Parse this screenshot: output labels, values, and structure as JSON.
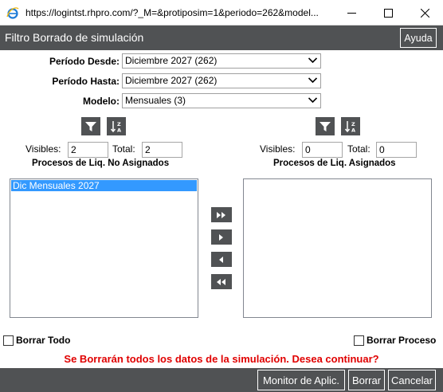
{
  "window": {
    "url": "https://logintst.rhpro.com/?_M=&protiposim=1&periodo=262&model...",
    "controls": [
      "minimize",
      "maximize",
      "close"
    ]
  },
  "header": {
    "title": "Filtro Borrado de simulación",
    "help_label": "Ayuda"
  },
  "form": {
    "periodo_desde": {
      "label": "Período Desde:",
      "value": "Diciembre 2027 (262)"
    },
    "periodo_hasta": {
      "label": "Período Hasta:",
      "value": "Diciembre 2027 (262)"
    },
    "modelo": {
      "label": "Modelo:",
      "value": "Mensuales (3)"
    }
  },
  "left_panel": {
    "visibles_label": "Visibles:",
    "visibles_value": "2",
    "total_label": "Total:",
    "total_value": "2",
    "title": "Procesos de Liq. No Asignados",
    "items": [
      "Dic Mensuales 2027"
    ]
  },
  "right_panel": {
    "visibles_label": "Visibles:",
    "visibles_value": "0",
    "total_label": "Total:",
    "total_value": "0",
    "title": "Procesos de Liq. Asignados",
    "items": []
  },
  "options": {
    "borrar_todo": "Borrar Todo",
    "borrar_proceso": "Borrar Proceso"
  },
  "warning": "Se Borrarán todos los datos de la simulación. Desea continuar?",
  "footer": {
    "monitor_label": "Monitor de Aplic.",
    "borrar_label": "Borrar",
    "cancelar_label": "Cancelar"
  },
  "colors": {
    "bar": "#505254",
    "selection": "#3399ff",
    "warning": "#e00000"
  }
}
